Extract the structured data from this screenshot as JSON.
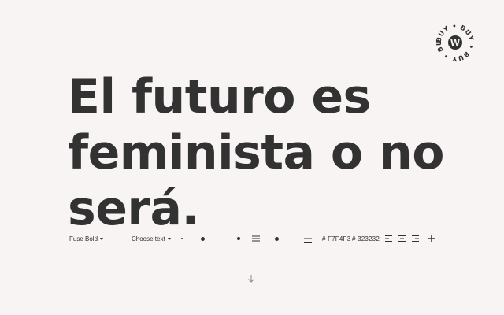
{
  "badge": {
    "ring_text": "BUY • BUY • BUY • BUY •",
    "center_letter": "W"
  },
  "specimen": {
    "lines": [
      "El futuro es",
      "feminista o no",
      "será."
    ]
  },
  "toolbar": {
    "font_select": "Fuse Bold",
    "text_select": "Choose text",
    "size_slider_value": 0.3,
    "leading_slider_value": 0.3,
    "background_color": "# F7F4F3",
    "text_color": "# 323232",
    "icons": {
      "size_small": "dot-small-icon",
      "size_large": "dot-large-icon",
      "leading_tight": "leading-tight-icon",
      "leading_loose": "leading-loose-icon",
      "align_left": "align-left-icon",
      "align_center": "align-center-icon",
      "align_right": "align-right-icon",
      "add": "plus-icon"
    }
  },
  "scroll_hint": {
    "icon": "arrow-down-icon"
  },
  "colors": {
    "background": "#F7F4F3",
    "text": "#323232"
  }
}
